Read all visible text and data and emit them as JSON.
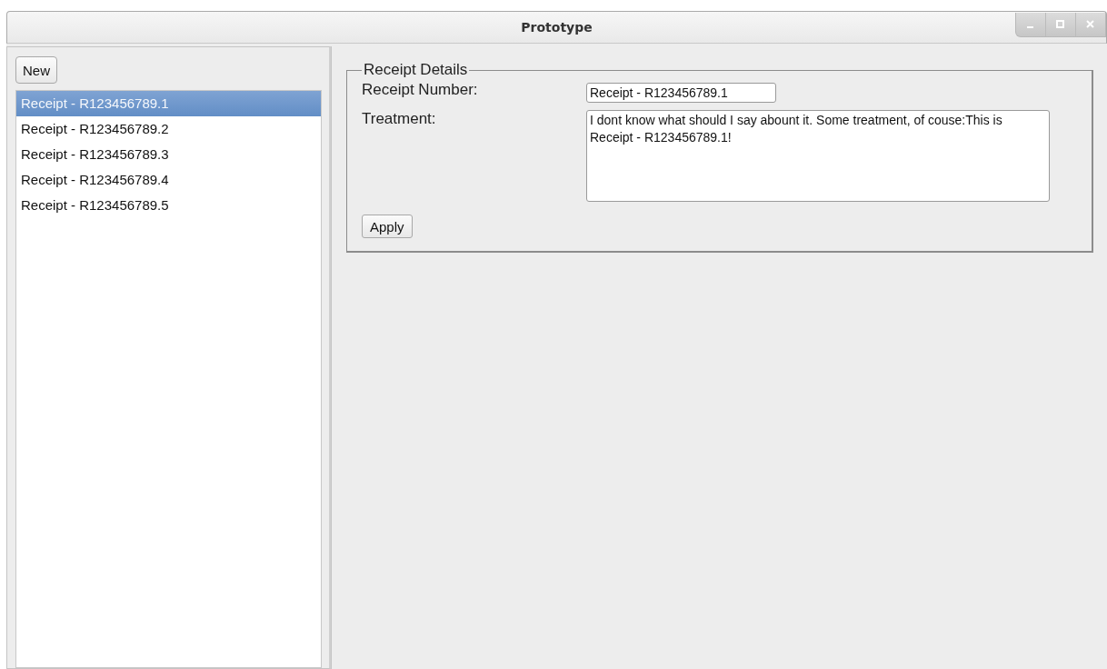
{
  "window": {
    "title": "Prototype"
  },
  "toolbar": {
    "new_button": "New"
  },
  "receipts": [
    {
      "label": "Receipt - R123456789.1",
      "selected": true
    },
    {
      "label": "Receipt - R123456789.2",
      "selected": false
    },
    {
      "label": "Receipt - R123456789.3",
      "selected": false
    },
    {
      "label": "Receipt - R123456789.4",
      "selected": false
    },
    {
      "label": "Receipt - R123456789.5",
      "selected": false
    }
  ],
  "details": {
    "title": "Receipt Details",
    "fields": [
      {
        "kind": "line",
        "label": "Receipt Number:",
        "value": "Receipt - R123456789.1"
      },
      {
        "kind": "area",
        "label": "Treatment:",
        "value": "I dont know what should I say abount it. Some treatment, of couse:This is Receipt - R123456789.1!"
      }
    ],
    "apply_button": "Apply"
  }
}
